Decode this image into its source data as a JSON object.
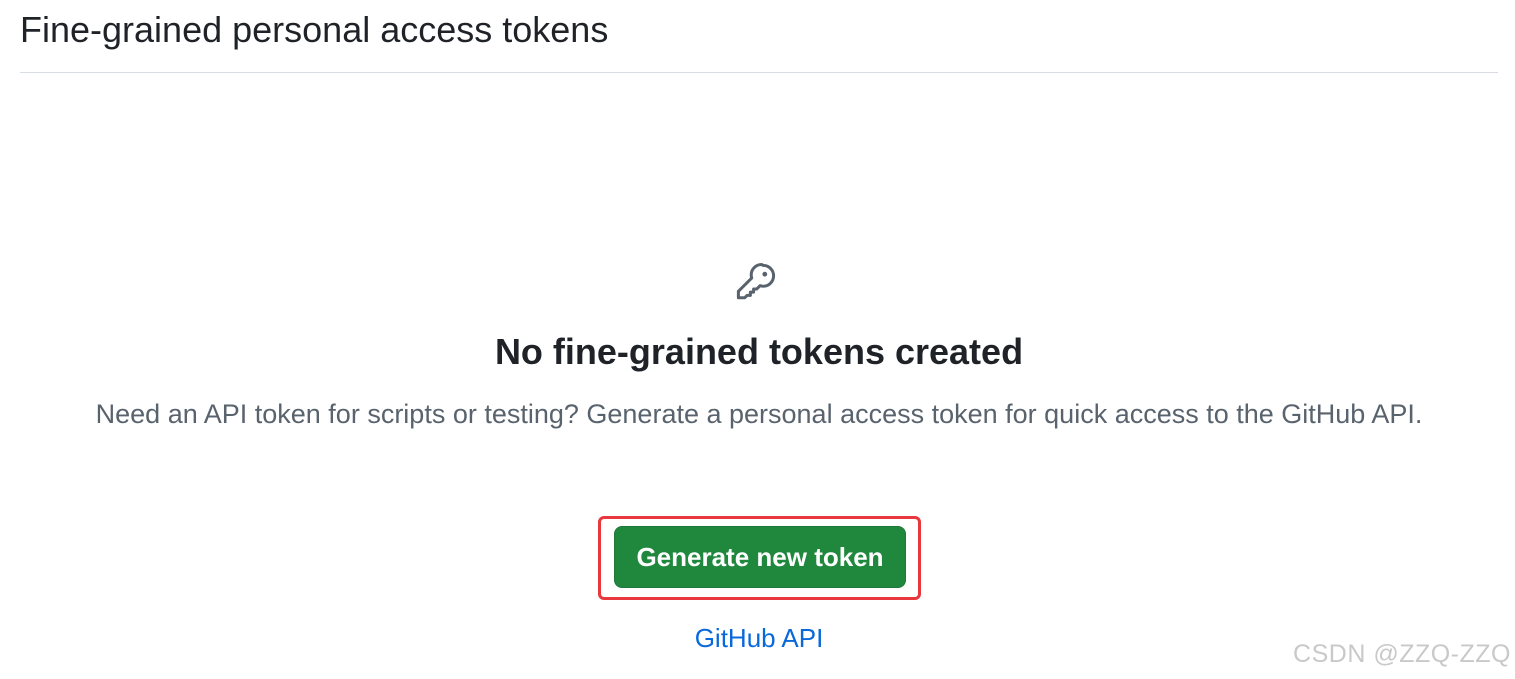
{
  "header": {
    "title": "Fine-grained personal access tokens"
  },
  "empty_state": {
    "icon": "key-icon",
    "heading": "No fine-grained tokens created",
    "description": "Need an API token for scripts or testing? Generate a personal access token for quick access to the GitHub API.",
    "primary_button_label": "Generate new token",
    "link_label": "GitHub API"
  },
  "annotation": {
    "highlight_color": "#e8373d"
  },
  "watermark": "CSDN @ZZQ-ZZQ",
  "colors": {
    "button_bg": "#1f883d",
    "link": "#0969da",
    "muted_text": "#59636e"
  }
}
